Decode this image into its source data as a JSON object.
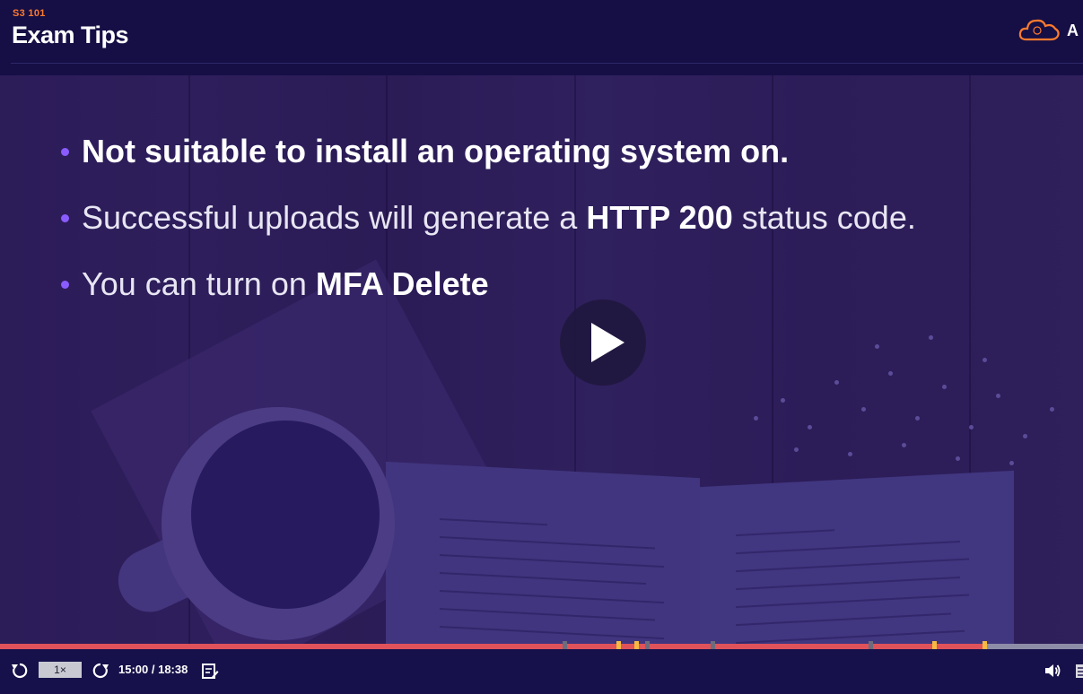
{
  "header": {
    "course_code": "S3 101",
    "title": "Exam Tips",
    "brand_letter": "A"
  },
  "slide": {
    "bullets": [
      {
        "parts": [
          {
            "text": "Not suitable to install an operating system on.",
            "bold": true
          }
        ]
      },
      {
        "parts": [
          {
            "text": "Successful uploads will generate a ",
            "bold": false
          },
          {
            "text": "HTTP 200",
            "bold": true
          },
          {
            "text": " status code.",
            "bold": false
          }
        ]
      },
      {
        "parts": [
          {
            "text": "You can turn on ",
            "bold": false
          },
          {
            "text": "MFA Delete",
            "bold": true
          }
        ]
      }
    ]
  },
  "player": {
    "speed": "1×",
    "time": "15:00 / 18:38",
    "progress_fraction": 0.911,
    "colors": {
      "played": "#e0525a",
      "remaining": "#8e8da8",
      "bookmark": "#f5b942",
      "chapter": "#6c6c7c"
    }
  }
}
